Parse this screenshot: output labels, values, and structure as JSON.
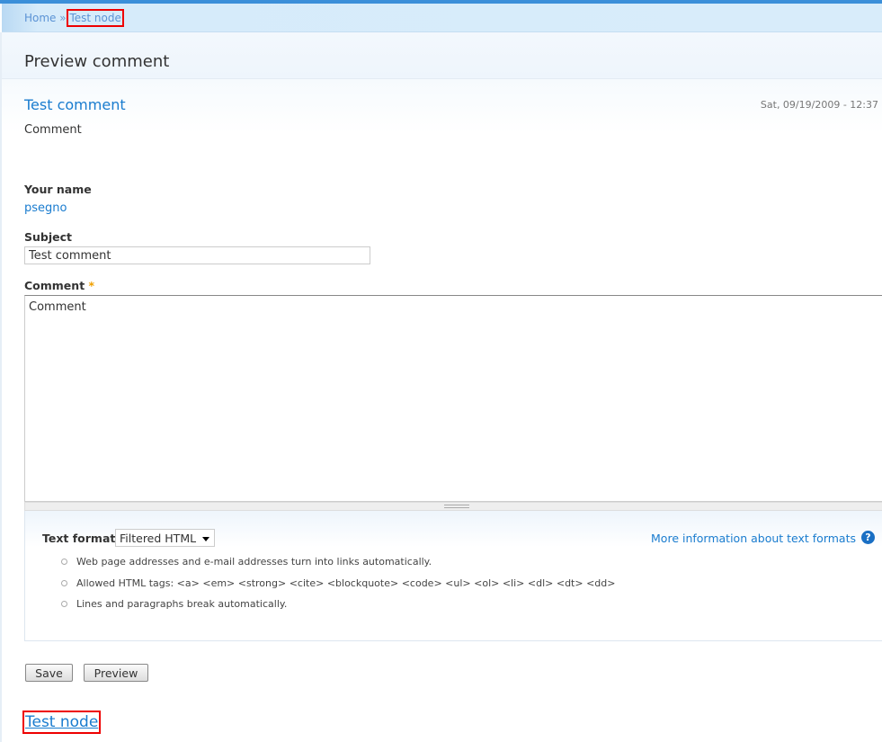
{
  "breadcrumb": {
    "home": "Home",
    "sep": "»",
    "current": "Test node"
  },
  "page_title": "Preview comment",
  "preview": {
    "title": "Test comment",
    "date": "Sat, 09/19/2009 - 12:37",
    "body": "Comment"
  },
  "form": {
    "name_label": "Your name",
    "name_value": "psegno",
    "subject_label": "Subject",
    "subject_value": "Test comment",
    "comment_label": "Comment",
    "required": "*",
    "comment_value": "Comment",
    "format_label": "Text format",
    "format_value": "Filtered HTML",
    "more_info": "More information about text formats",
    "help": "?",
    "tips": [
      "Web page addresses and e-mail addresses turn into links automatically.",
      "Allowed HTML tags: <a> <em> <strong> <cite> <blockquote> <code> <ul> <ol> <li> <dl> <dt> <dd>",
      "Lines and paragraphs break automatically."
    ],
    "save": "Save",
    "preview": "Preview"
  },
  "footer_link": "Test node"
}
